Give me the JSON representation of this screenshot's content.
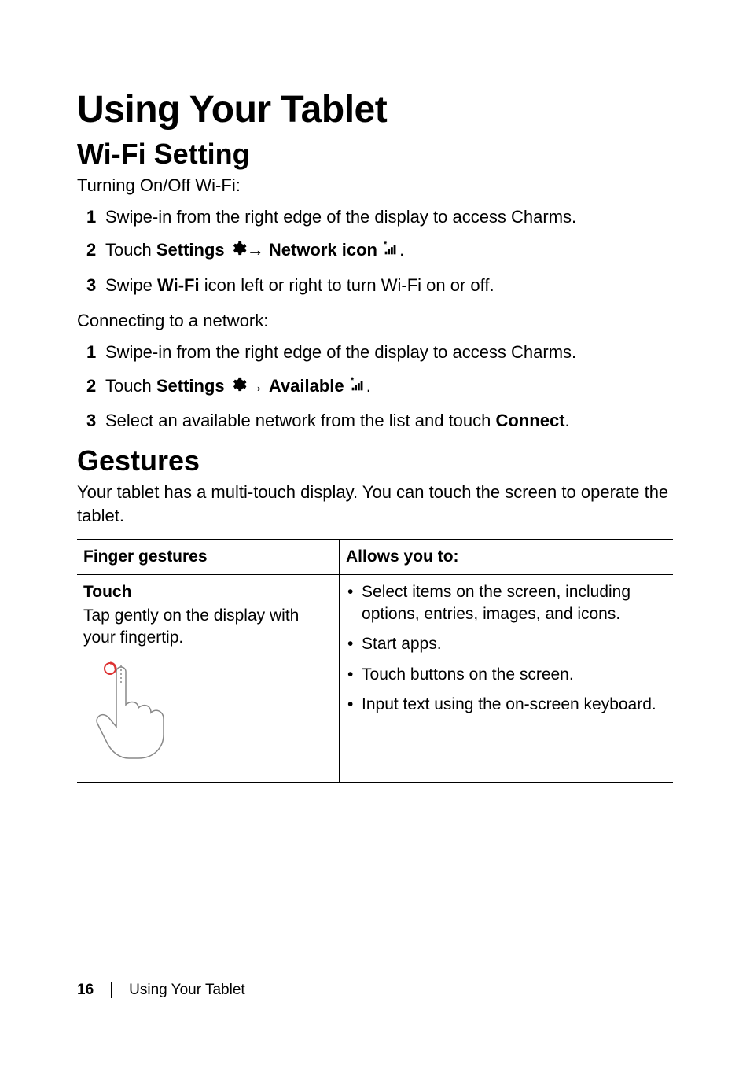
{
  "title": "Using Your Tablet",
  "sections": {
    "wifi": {
      "heading": "Wi-Fi Setting",
      "turning_label": "Turning On/Off Wi-Fi:",
      "turning_steps": [
        {
          "pre": "Swipe-in from the right edge of the display to access Charms."
        },
        {
          "pre": "Touch ",
          "b1": "Settings ",
          "mid1": "→ ",
          "b2": "Network icon ",
          "post": "."
        },
        {
          "pre": "Swipe ",
          "b1": "Wi-Fi",
          "post": " icon left or right to turn Wi-Fi on or off."
        }
      ],
      "connecting_label": "Connecting to a network:",
      "connecting_steps": [
        {
          "pre": "Swipe-in from the right edge of the display to access Charms."
        },
        {
          "pre": "Touch ",
          "b1": "Settings ",
          "mid1": "→ ",
          "b2": "Available ",
          "post": "."
        },
        {
          "pre": "Select an available network from the list and touch ",
          "b1": "Connect",
          "post": "."
        }
      ]
    },
    "gestures": {
      "heading": "Gestures",
      "intro": "Your tablet has a multi-touch display. You can touch the screen to operate the tablet.",
      "table": {
        "col1": "Finger gestures",
        "col2": "Allows you to:",
        "rows": [
          {
            "name": "Touch",
            "desc": "Tap gently on the display with your fingertip.",
            "allows": [
              "Select items on the screen, including options, entries, images, and icons.",
              "Start apps.",
              "Touch buttons on the screen.",
              "Input text using the on-screen keyboard."
            ]
          }
        ]
      }
    }
  },
  "footer": {
    "page": "16",
    "section": "Using Your Tablet"
  }
}
